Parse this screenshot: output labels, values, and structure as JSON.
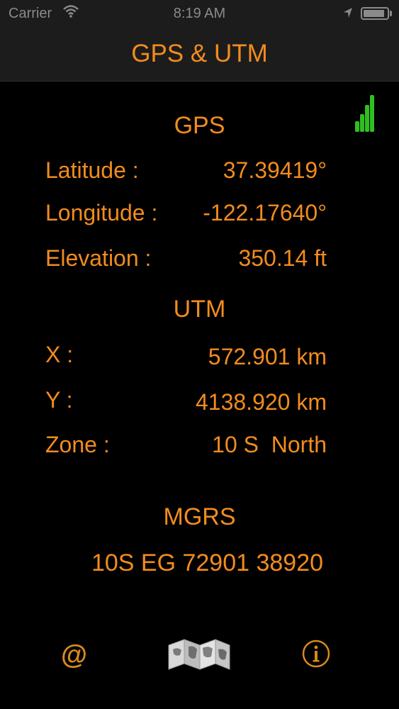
{
  "status_bar": {
    "carrier": "Carrier",
    "time": "8:19 AM",
    "wifi_icon": "wifi-icon",
    "location_icon": "location-arrow-icon",
    "battery_icon": "battery-icon",
    "battery_level_percent": 90
  },
  "nav": {
    "title": "GPS & UTM"
  },
  "signal_icon": {
    "name": "signal-strength-icon",
    "color": "#2fbf1f"
  },
  "gps": {
    "title": "GPS",
    "latitude_label": "Latitude :",
    "latitude_value": "37.39419°",
    "longitude_label": "Longitude :",
    "longitude_value": "-122.17640°",
    "elevation_label": "Elevation :",
    "elevation_value": "350.14 ft"
  },
  "utm": {
    "title": "UTM",
    "x_label": "X :",
    "x_value": "572.901 km",
    "y_label": "Y :",
    "y_value": "4138.920 km",
    "zone_label": "Zone :",
    "zone_value": "10 S  North"
  },
  "mgrs": {
    "title": "MGRS",
    "value": "10S EG 72901 38920"
  },
  "toolbar": {
    "email_glyph": "@",
    "map_icon": "folded-map-icon",
    "info_icon": "info-icon"
  },
  "colors": {
    "accent": "#f28c1e",
    "background": "#000000",
    "bar": "#1c1c1c"
  }
}
